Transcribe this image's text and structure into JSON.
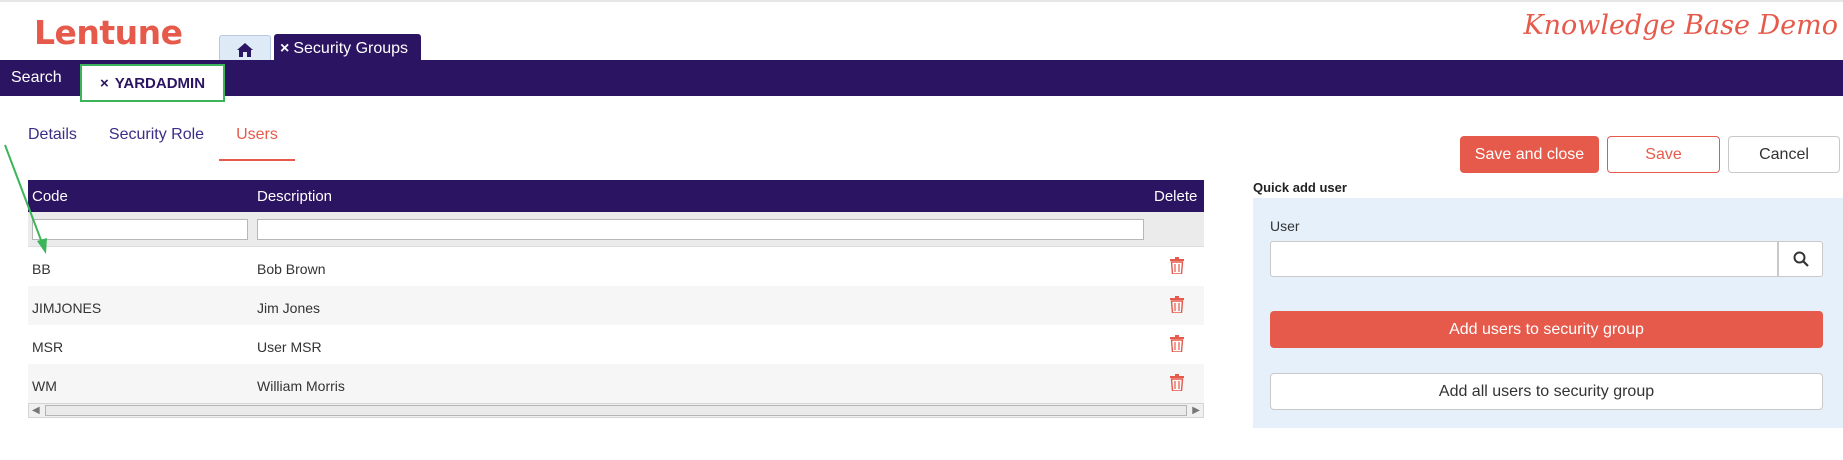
{
  "header": {
    "logo": "Lentune",
    "banner": "Knowledge Base Demo",
    "home_icon": "home-icon",
    "top_tab": {
      "close": "×",
      "label": "Security Groups"
    }
  },
  "navbar": {
    "search_label": "Search",
    "record_tab": {
      "close": "×",
      "label": "YARDADMIN"
    }
  },
  "subtabs": [
    {
      "label": "Details",
      "active": false
    },
    {
      "label": "Security Role",
      "active": false
    },
    {
      "label": "Users",
      "active": true
    }
  ],
  "actions": {
    "save_close": "Save and close",
    "save": "Save",
    "cancel": "Cancel"
  },
  "grid": {
    "columns": [
      "Code",
      "Description",
      "Delete"
    ],
    "rows": [
      {
        "code": "BB",
        "description": "Bob Brown"
      },
      {
        "code": "JIMJONES",
        "description": "Jim Jones"
      },
      {
        "code": "MSR",
        "description": "User MSR"
      },
      {
        "code": "WM",
        "description": "William Morris"
      }
    ]
  },
  "quick_add": {
    "title": "Quick add user",
    "user_label": "User",
    "user_value": "",
    "add_button": "Add users to security group",
    "add_all_button": "Add all users to security group"
  },
  "colors": {
    "brand": "#e55a4b",
    "navy": "#2b1461",
    "highlight": "#3cb55a"
  }
}
